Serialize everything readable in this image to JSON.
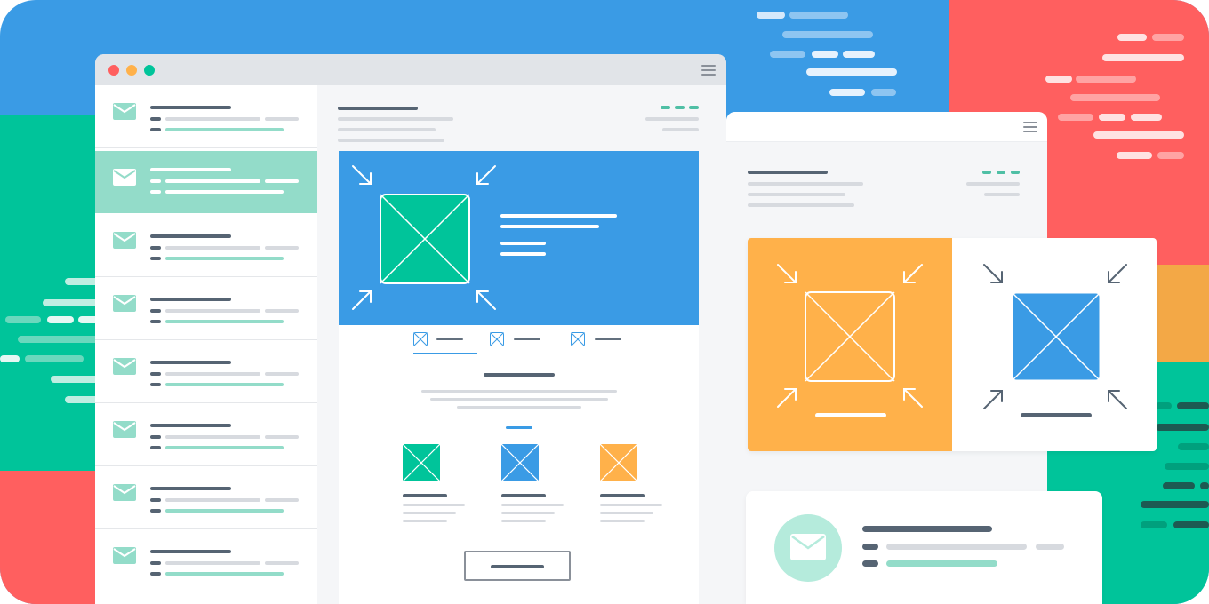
{
  "illustration": {
    "title": "",
    "colors": {
      "blue": "#3a9be5",
      "red": "#ff5f5f",
      "green": "#00c49a",
      "orange": "#ffb14a",
      "mint": "#93dcc9",
      "slate": "#566473",
      "light_gray": "#d7dadf",
      "white": "#ffffff"
    },
    "icons": {
      "mail": "envelope-icon",
      "image": "image-placeholder-icon",
      "menu": "hamburger-menu-icon",
      "expand": "expand-arrows-icon",
      "shrink": "shrink-arrows-icon"
    },
    "mail_list_items": 8,
    "selected_item": 2
  }
}
